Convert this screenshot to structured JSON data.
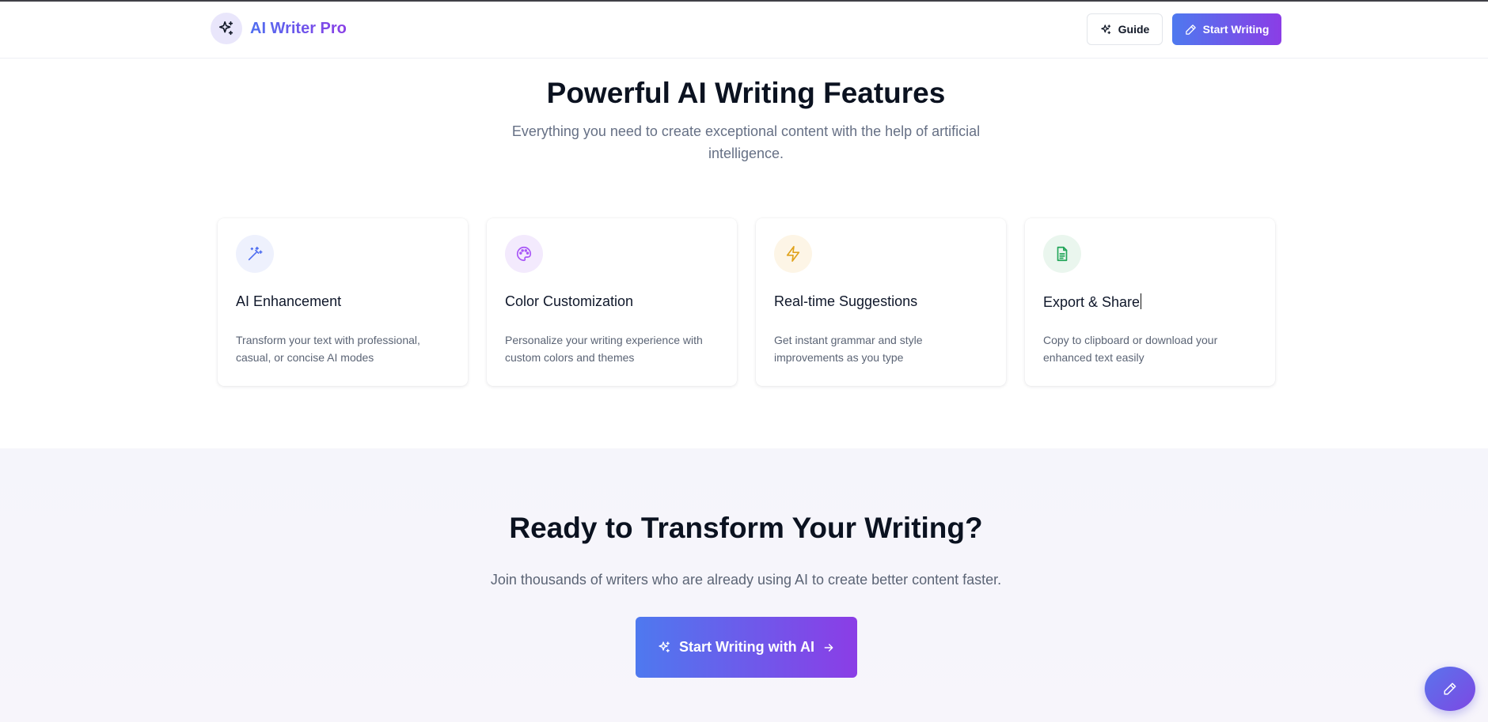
{
  "header": {
    "brand_name": "AI Writer Pro",
    "guide_label": "Guide",
    "start_label": "Start Writing"
  },
  "features": {
    "title": "Powerful AI Writing Features",
    "subtitle": "Everything you need to create exceptional content with the help of artificial intelligence.",
    "cards": [
      {
        "icon": "magic-wand-icon",
        "icon_color": "#4f6ef0",
        "icon_bg": "#eef1fd",
        "title": "AI Enhancement",
        "desc": "Transform your text with professional, casual, or concise AI modes"
      },
      {
        "icon": "palette-icon",
        "icon_color": "#a855f7",
        "icon_bg": "#f3eafd",
        "title": "Color Customization",
        "desc": "Personalize your writing experience with custom colors and themes"
      },
      {
        "icon": "zap-icon",
        "icon_color": "#e0a21a",
        "icon_bg": "#fdf5e6",
        "title": "Real-time Suggestions",
        "desc": "Get instant grammar and style improvements as you type"
      },
      {
        "icon": "file-text-icon",
        "icon_color": "#22a559",
        "icon_bg": "#eaf6ee",
        "title": "Export & Share",
        "desc": "Copy to clipboard or download your enhanced text easily"
      }
    ]
  },
  "cta": {
    "title": "Ready to Transform Your Writing?",
    "subtitle": "Join thousands of writers who are already using AI to create better content faster.",
    "button_label": "Start Writing with AI"
  },
  "colors": {
    "accent_start": "#4e79ef",
    "accent_end": "#8b3de6"
  }
}
